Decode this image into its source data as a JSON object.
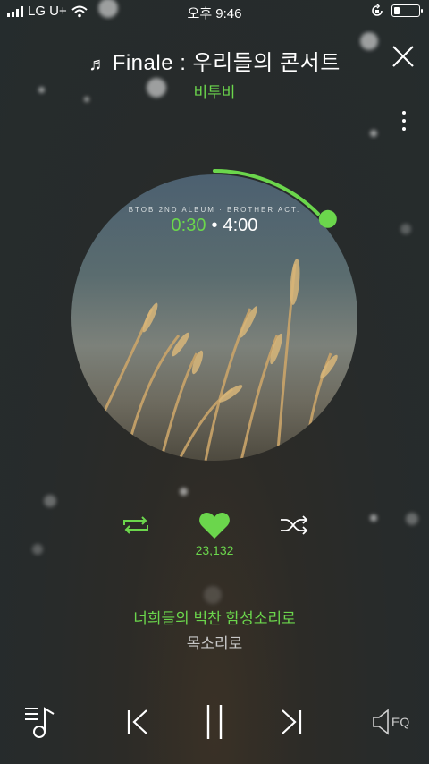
{
  "status_bar": {
    "carrier": "LG U+",
    "time": "오후 9:46",
    "battery_level": 0.25
  },
  "header": {
    "title": "Finale : 우리들의 콘서트",
    "artist": "비투비"
  },
  "album": {
    "caption": "BTOB 2ND ALBUM · BROTHER ACT.",
    "current_time": "0:30",
    "separator": "•",
    "total_time": "4:00",
    "progress": 0.125
  },
  "actions": {
    "like_count": "23,132"
  },
  "lyrics": {
    "current_line": "너희들의 벅찬 함성소리로",
    "next_line": "목소리로"
  },
  "bottom": {
    "eq_label": "EQ"
  },
  "colors": {
    "accent": "#6bd64c",
    "text": "#ffffff"
  },
  "icons": [
    "signal-icon",
    "wifi-icon",
    "rotation-lock-icon",
    "battery-icon",
    "microphone-icon",
    "close-icon",
    "more-icon",
    "repeat-icon",
    "heart-icon",
    "shuffle-icon",
    "playlist-icon",
    "previous-icon",
    "pause-icon",
    "next-icon",
    "eq-icon"
  ]
}
